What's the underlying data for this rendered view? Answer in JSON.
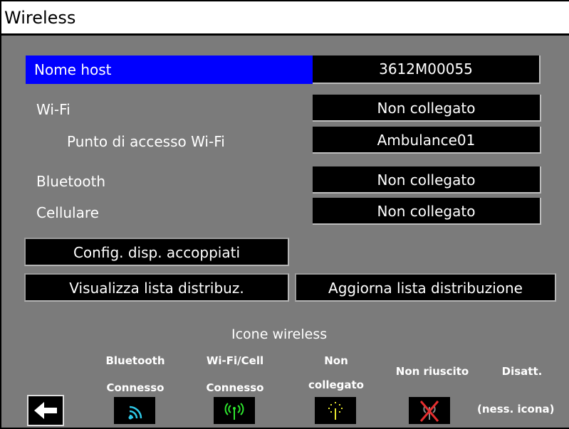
{
  "window": {
    "title": "Wireless"
  },
  "settings": {
    "host": {
      "label": "Nome host",
      "value": "3612M00055"
    },
    "wifi": {
      "label": "Wi-Fi",
      "value": "Non collegato"
    },
    "access_point": {
      "label": "Punto di accesso Wi-Fi",
      "value": "Ambulance01"
    },
    "bluetooth": {
      "label": "Bluetooth",
      "value": "Non collegato"
    },
    "cellular": {
      "label": "Cellulare",
      "value": "Non collegato"
    }
  },
  "buttons": {
    "config_paired": "Config. disp. accoppiati",
    "view_list": "Visualizza lista distribuz.",
    "update_list": "Aggiorna lista distribuzione"
  },
  "legend": {
    "title": "Icone wireless",
    "items": [
      {
        "line1": "Bluetooth",
        "line2": "Connesso",
        "icon": "bluetooth-connected-icon",
        "color": "#2ec7e6"
      },
      {
        "line1": "Wi-Fi/Cell",
        "line2": "Connesso",
        "icon": "wifi-connected-icon",
        "color": "#2ee62e"
      },
      {
        "line1": "Non",
        "line2": "collegato",
        "icon": "not-connected-icon",
        "color": "#e6e62e"
      },
      {
        "line1": "Non riuscito",
        "line2": "",
        "icon": "failed-icon",
        "color": "#e62e2e"
      },
      {
        "line1": "Disatt.",
        "line2": "(ness. icona)",
        "icon": "none"
      }
    ]
  },
  "nav": {
    "back_icon": "back-arrow-icon"
  }
}
